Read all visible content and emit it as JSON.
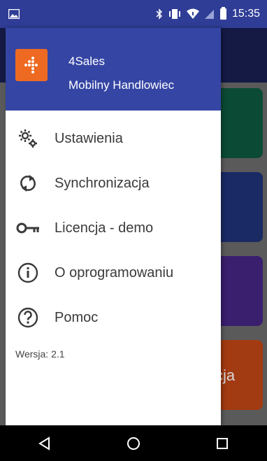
{
  "status_bar": {
    "time": "15:35",
    "icons": [
      "image-icon",
      "bluetooth-icon",
      "vibrate-icon",
      "wifi-icon",
      "signal-icon",
      "battery-icon"
    ]
  },
  "drawer": {
    "app_name": "4Sales",
    "app_subtitle": "Mobilny Handlowiec",
    "logo_color": "#ee6a22",
    "header_color": "#3545a4",
    "menu": [
      {
        "label": "Ustawienia",
        "icon": "gear-icon"
      },
      {
        "label": "Synchronizacja",
        "icon": "sync-icon"
      },
      {
        "label": "Licencja - demo",
        "icon": "key-icon"
      },
      {
        "label": "O oprogramowaniu",
        "icon": "info-icon"
      },
      {
        "label": "Pomoc",
        "icon": "help-icon"
      }
    ],
    "version": "Wersja: 2.1"
  },
  "background": {
    "visible_label": "cja",
    "tile_colors": [
      "#0b4a34",
      "#1a2a64",
      "#3a1f6e",
      "#a23a12"
    ]
  },
  "navbar": {
    "buttons": [
      "back-icon",
      "home-icon",
      "recents-icon"
    ]
  }
}
